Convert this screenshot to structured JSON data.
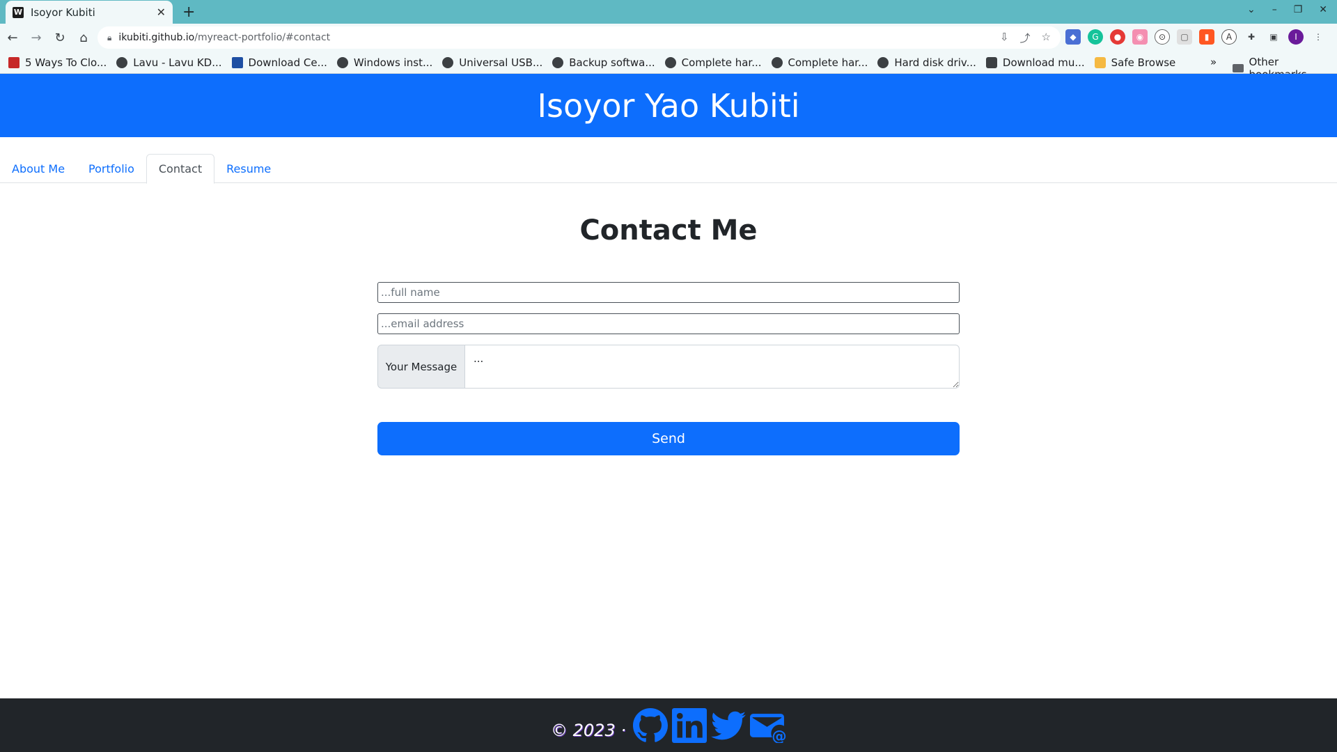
{
  "browser": {
    "tab_title": "Isoyor Kubiti",
    "tab_favicon": "W",
    "url_host": "ikubiti.github.io",
    "url_path": "/myreact-portfolio/#contact",
    "bookmarks": [
      "5 Ways To Clo...",
      "Lavu - Lavu KD...",
      "Download Ce...",
      "Windows inst...",
      "Universal USB...",
      "Backup softwa...",
      "Complete har...",
      "Complete har...",
      "Hard disk driv...",
      "Download mu...",
      "Safe Browse"
    ],
    "bookmarks_more": "»",
    "other_bookmarks": "Other bookmarks",
    "avatar_letter": "I"
  },
  "site": {
    "header_title": "Isoyor Yao Kubiti",
    "nav": [
      "About Me",
      "Portfolio",
      "Contact",
      "Resume"
    ],
    "active_nav": "Contact"
  },
  "contact": {
    "title": "Contact Me",
    "name_placeholder": "...full name",
    "email_placeholder": "...email address",
    "message_label": "Your Message",
    "message_placeholder": "...",
    "send_label": "Send"
  },
  "footer": {
    "copyright": "© 2023 ·",
    "icons": [
      "github-icon",
      "linkedin-icon",
      "twitter-icon",
      "email-icon"
    ],
    "icon_color": "#0d6efd"
  }
}
